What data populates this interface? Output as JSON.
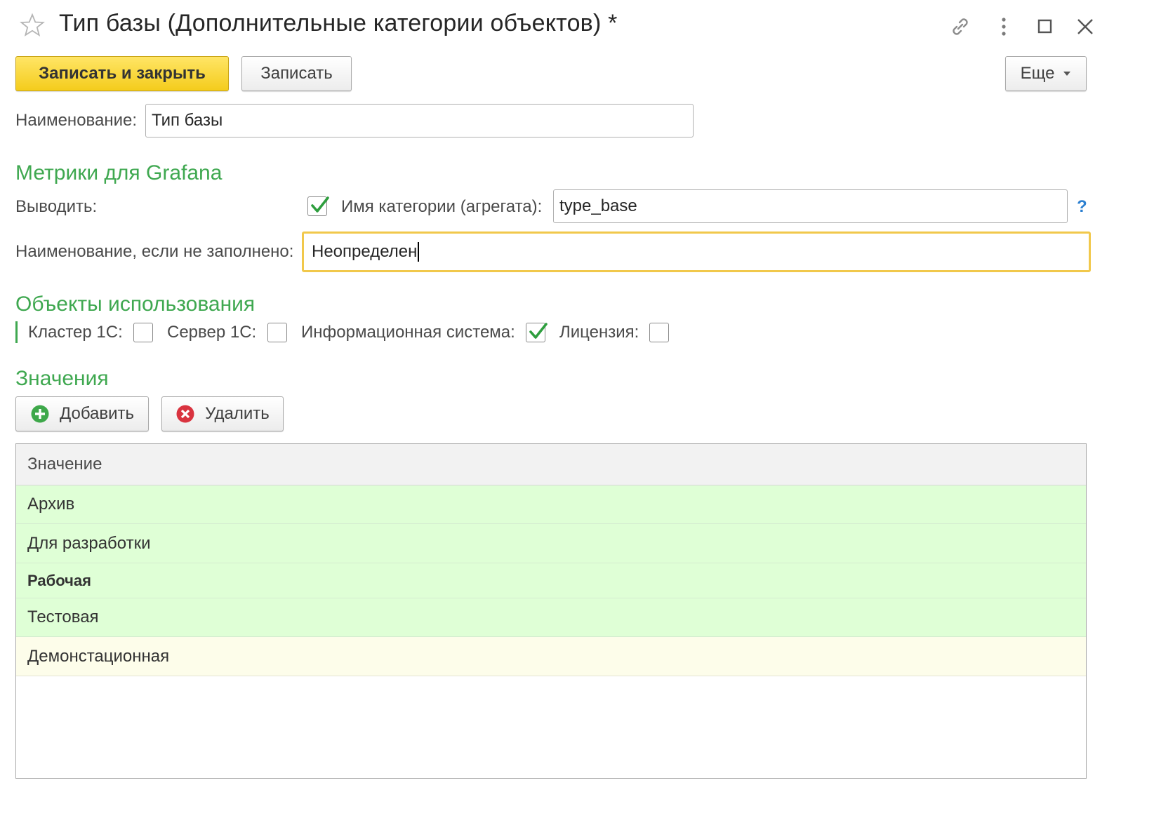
{
  "window": {
    "title": "Тип базы (Дополнительные категории объектов) *"
  },
  "toolbar": {
    "save_close_label": "Записать и закрыть",
    "save_label": "Записать",
    "more_label": "Еще"
  },
  "form": {
    "name_label": "Наименование:",
    "name_value": "Тип базы"
  },
  "grafana": {
    "section_title": "Метрики для Grafana",
    "output_label": "Выводить:",
    "output_checked": true,
    "category_label": "Имя категории (агрегата):",
    "category_value": "type_base",
    "help_label": "?",
    "default_name_label": "Наименование, если не заполнено:",
    "default_name_value": "Неопределен"
  },
  "usage": {
    "section_title": "Объекты использования",
    "items": [
      {
        "label": "Кластер 1С:",
        "checked": false
      },
      {
        "label": "Сервер 1С:",
        "checked": false
      },
      {
        "label": "Информационная система:",
        "checked": true
      },
      {
        "label": "Лицензия:",
        "checked": false
      }
    ]
  },
  "values": {
    "section_title": "Значения",
    "add_label": "Добавить",
    "delete_label": "Удалить",
    "column_header": "Значение",
    "rows": [
      {
        "text": "Архив",
        "style": "green"
      },
      {
        "text": "Для разработки",
        "style": "green"
      },
      {
        "text": "Рабочая",
        "style": "green-bold"
      },
      {
        "text": "Тестовая",
        "style": "green"
      },
      {
        "text": "Демонстационная",
        "style": "cream"
      }
    ]
  },
  "colors": {
    "accent_yellow": "#f4cc1c",
    "section_green": "#3fa850",
    "row_green": "#dfffd6",
    "row_cream": "#fdfdea",
    "focus_border": "#f1c84b"
  }
}
